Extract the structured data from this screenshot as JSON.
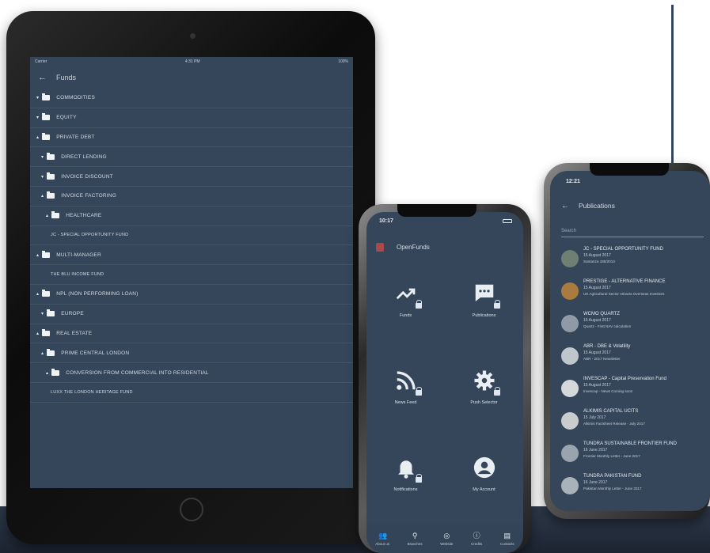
{
  "colors": {
    "screen_bg": "#36465a",
    "floor": "#2e3a4b",
    "text": "#d3dae2"
  },
  "tablet": {
    "status": {
      "carrier": "Carrier",
      "time": "4:31 PM",
      "battery": "100%"
    },
    "header": {
      "back_icon": "arrow-left-icon",
      "title": "Funds"
    },
    "tree": [
      {
        "label": "COMMODITIES",
        "level": 0,
        "folder": true,
        "caret": "▾"
      },
      {
        "label": "EQUITY",
        "level": 0,
        "folder": true,
        "caret": "▾"
      },
      {
        "label": "PRIVATE DEBT",
        "level": 0,
        "folder": true,
        "caret": "▴"
      },
      {
        "label": "DIRECT LENDING",
        "level": 1,
        "folder": true,
        "caret": "▾"
      },
      {
        "label": "INVOICE DISCOUNT",
        "level": 1,
        "folder": true,
        "caret": "▾"
      },
      {
        "label": "INVOICE FACTORING",
        "level": 1,
        "folder": true,
        "caret": "▴"
      },
      {
        "label": "HEALTHCARE",
        "level": 2,
        "folder": true,
        "caret": "▴"
      },
      {
        "label": "JC - SPECIAL OPPORTUNITY FUND",
        "level": 3,
        "folder": false,
        "caret": ""
      },
      {
        "label": "MULTI-MANAGER",
        "level": 0,
        "folder": true,
        "caret": "▴"
      },
      {
        "label": "THE BLU INCOME FUND",
        "level": 3,
        "folder": false,
        "caret": ""
      },
      {
        "label": "NPL (NON PERFORMING LOAN)",
        "level": 0,
        "folder": true,
        "caret": "▴"
      },
      {
        "label": "EUROPE",
        "level": 1,
        "folder": true,
        "caret": "▾"
      },
      {
        "label": "REAL ESTATE",
        "level": 0,
        "folder": true,
        "caret": "▴"
      },
      {
        "label": "PRIME CENTRAL LONDON",
        "level": 1,
        "folder": true,
        "caret": "▴"
      },
      {
        "label": "CONVERSION FROM COMMERCIAL INTO RESIDENTIAL",
        "level": 2,
        "folder": true,
        "caret": "▴"
      },
      {
        "label": "LUXX THE LONDON HERITAGE FUND",
        "level": 3,
        "folder": false,
        "caret": ""
      }
    ]
  },
  "phone1": {
    "status": {
      "time": "10:17"
    },
    "header": {
      "title": "OpenFunds"
    },
    "tiles": [
      {
        "label": "Funds",
        "icon": "trending-up-icon"
      },
      {
        "label": "Publications",
        "icon": "chat-icon"
      },
      {
        "label": "News Feed",
        "icon": "rss-icon"
      },
      {
        "label": "Push Selector",
        "icon": "gear-icon"
      },
      {
        "label": "Notifications",
        "icon": "bell-icon"
      },
      {
        "label": "My Account",
        "icon": "account-icon"
      }
    ],
    "bottom_nav": [
      {
        "label": "About us",
        "icon": "people-icon"
      },
      {
        "label": "Branches",
        "icon": "pin-icon"
      },
      {
        "label": "Website",
        "icon": "globe-icon"
      },
      {
        "label": "Credits",
        "icon": "info-icon"
      },
      {
        "label": "Contacts",
        "icon": "message-icon"
      }
    ]
  },
  "phone2": {
    "status": {
      "time": "12:21"
    },
    "header": {
      "back_icon": "arrow-left-icon",
      "title": "Publications"
    },
    "search": {
      "placeholder": "Search"
    },
    "items": [
      {
        "title": "JC - SPECIAL OPPORTUNITY FUND",
        "date": "15 August 2017",
        "subtitle": "Santanza 186/2013",
        "thumb": "#6f7f73"
      },
      {
        "title": "PRESTIGE - ALTERNATIVE FINANCE",
        "date": "15 August 2017",
        "subtitle": "UK Agricultural Sector Attracts Overseas Investors",
        "thumb": "#a97b3f"
      },
      {
        "title": "WCMO QUARTZ",
        "date": "15 August 2017",
        "subtitle": "Quartz - First NAV calculation",
        "thumb": "#8f9aa6"
      },
      {
        "title": "ABR - DBE & Volatility",
        "date": "15 August 2017",
        "subtitle": "ABR - 2017 Newsletter",
        "thumb": "#bfc6cc"
      },
      {
        "title": "INVESCAP - Capital Preservation Fund",
        "date": "15 August 2017",
        "subtitle": "Invescap - News Coming soon",
        "thumb": "#d6d9dc"
      },
      {
        "title": "ALKIMIS CAPITAL UCITS",
        "date": "15 July 2017",
        "subtitle": "Alkimis Factsheet Release - July 2017",
        "thumb": "#c9ccce"
      },
      {
        "title": "TUNDRA SUSTAINABLE FRONTIER FUND",
        "date": "16 June 2017",
        "subtitle": "Frontier Monthly Letter - June 2017",
        "thumb": "#9aa4ae"
      },
      {
        "title": "TUNDRA PAKISTAN FUND",
        "date": "16 June 2017",
        "subtitle": "Pakistan Monthly Letter - June 2017",
        "thumb": "#a9b1b9"
      }
    ]
  }
}
